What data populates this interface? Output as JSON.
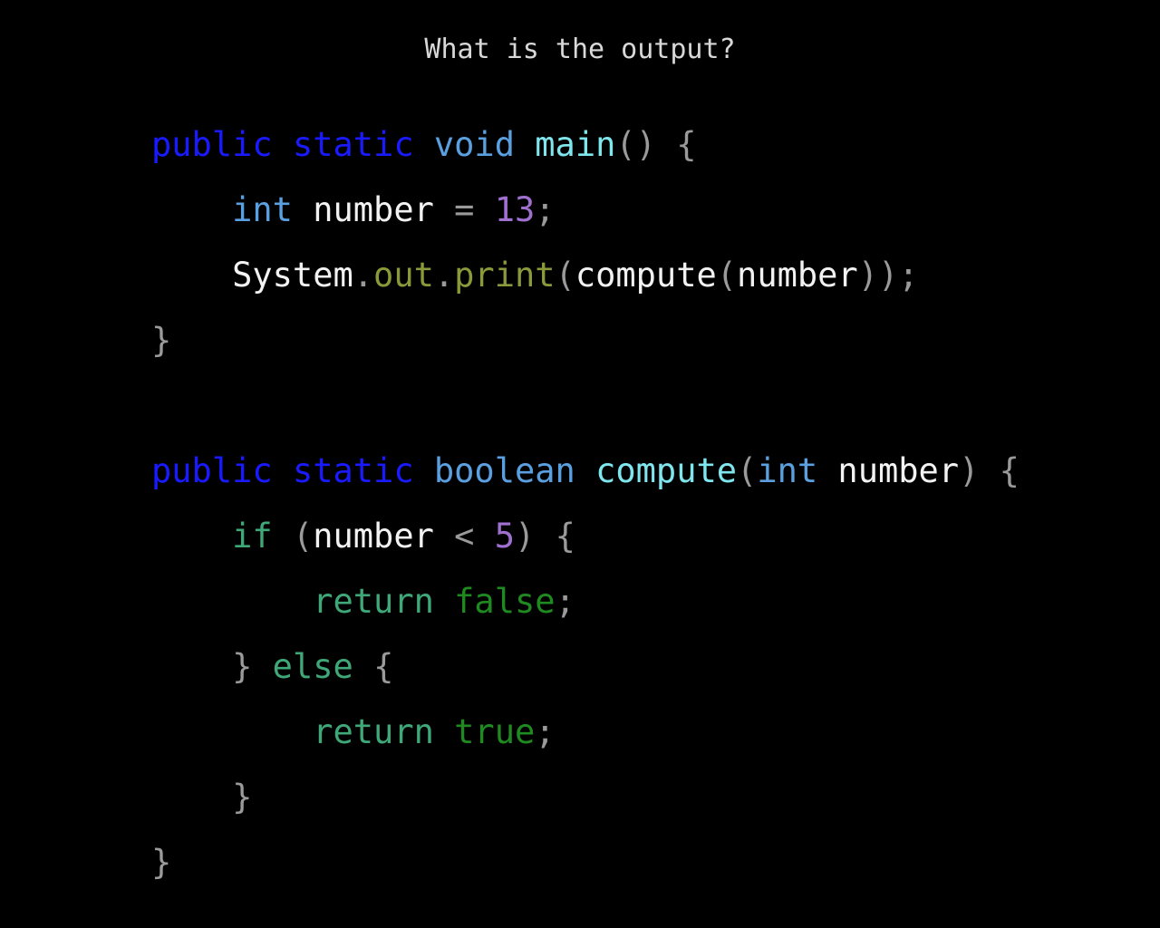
{
  "question": "What is the output?",
  "colors": {
    "background": "#000000",
    "question": "#d8d8d8",
    "modifier": "#1a1aff",
    "type": "#5aa0e0",
    "method": "#7fe6ee",
    "identifier": "#f2f2f2",
    "punctuation": "#9a9a9a",
    "number": "#a070d0",
    "member": "#8a9a3a",
    "control": "#3fa878",
    "literal": "#1f8a1f",
    "returnKeyword": "#3fa878"
  },
  "code": [
    [
      {
        "t": "public",
        "c": "modifier"
      },
      {
        "t": " ",
        "c": "identifier"
      },
      {
        "t": "static",
        "c": "modifier"
      },
      {
        "t": " ",
        "c": "identifier"
      },
      {
        "t": "void",
        "c": "type"
      },
      {
        "t": " ",
        "c": "identifier"
      },
      {
        "t": "main",
        "c": "method"
      },
      {
        "t": "()",
        "c": "punctuation"
      },
      {
        "t": " ",
        "c": "identifier"
      },
      {
        "t": "{",
        "c": "punctuation"
      }
    ],
    [
      {
        "t": "    ",
        "c": "identifier"
      },
      {
        "t": "int",
        "c": "type"
      },
      {
        "t": " ",
        "c": "identifier"
      },
      {
        "t": "number",
        "c": "identifier"
      },
      {
        "t": " ",
        "c": "identifier"
      },
      {
        "t": "=",
        "c": "punctuation"
      },
      {
        "t": " ",
        "c": "identifier"
      },
      {
        "t": "13",
        "c": "number"
      },
      {
        "t": ";",
        "c": "punctuation"
      }
    ],
    [
      {
        "t": "    ",
        "c": "identifier"
      },
      {
        "t": "System",
        "c": "identifier"
      },
      {
        "t": ".",
        "c": "punctuation"
      },
      {
        "t": "out",
        "c": "member"
      },
      {
        "t": ".",
        "c": "punctuation"
      },
      {
        "t": "print",
        "c": "member"
      },
      {
        "t": "(",
        "c": "punctuation"
      },
      {
        "t": "compute",
        "c": "identifier"
      },
      {
        "t": "(",
        "c": "punctuation"
      },
      {
        "t": "number",
        "c": "identifier"
      },
      {
        "t": "));",
        "c": "punctuation"
      }
    ],
    [
      {
        "t": "}",
        "c": "punctuation"
      }
    ],
    [],
    [
      {
        "t": "public",
        "c": "modifier"
      },
      {
        "t": " ",
        "c": "identifier"
      },
      {
        "t": "static",
        "c": "modifier"
      },
      {
        "t": " ",
        "c": "identifier"
      },
      {
        "t": "boolean",
        "c": "type"
      },
      {
        "t": " ",
        "c": "identifier"
      },
      {
        "t": "compute",
        "c": "method"
      },
      {
        "t": "(",
        "c": "punctuation"
      },
      {
        "t": "int",
        "c": "type"
      },
      {
        "t": " ",
        "c": "identifier"
      },
      {
        "t": "number",
        "c": "identifier"
      },
      {
        "t": ")",
        "c": "punctuation"
      },
      {
        "t": " ",
        "c": "identifier"
      },
      {
        "t": "{",
        "c": "punctuation"
      }
    ],
    [
      {
        "t": "    ",
        "c": "identifier"
      },
      {
        "t": "if",
        "c": "control"
      },
      {
        "t": " ",
        "c": "identifier"
      },
      {
        "t": "(",
        "c": "punctuation"
      },
      {
        "t": "number",
        "c": "identifier"
      },
      {
        "t": " ",
        "c": "identifier"
      },
      {
        "t": "<",
        "c": "punctuation"
      },
      {
        "t": " ",
        "c": "identifier"
      },
      {
        "t": "5",
        "c": "number"
      },
      {
        "t": ")",
        "c": "punctuation"
      },
      {
        "t": " ",
        "c": "identifier"
      },
      {
        "t": "{",
        "c": "punctuation"
      }
    ],
    [
      {
        "t": "        ",
        "c": "identifier"
      },
      {
        "t": "return",
        "c": "returnKeyword"
      },
      {
        "t": " ",
        "c": "identifier"
      },
      {
        "t": "false",
        "c": "literal"
      },
      {
        "t": ";",
        "c": "punctuation"
      }
    ],
    [
      {
        "t": "    ",
        "c": "identifier"
      },
      {
        "t": "}",
        "c": "punctuation"
      },
      {
        "t": " ",
        "c": "identifier"
      },
      {
        "t": "else",
        "c": "control"
      },
      {
        "t": " ",
        "c": "identifier"
      },
      {
        "t": "{",
        "c": "punctuation"
      }
    ],
    [
      {
        "t": "        ",
        "c": "identifier"
      },
      {
        "t": "return",
        "c": "returnKeyword"
      },
      {
        "t": " ",
        "c": "identifier"
      },
      {
        "t": "true",
        "c": "literal"
      },
      {
        "t": ";",
        "c": "punctuation"
      }
    ],
    [
      {
        "t": "    ",
        "c": "identifier"
      },
      {
        "t": "}",
        "c": "punctuation"
      }
    ],
    [
      {
        "t": "}",
        "c": "punctuation"
      }
    ]
  ]
}
